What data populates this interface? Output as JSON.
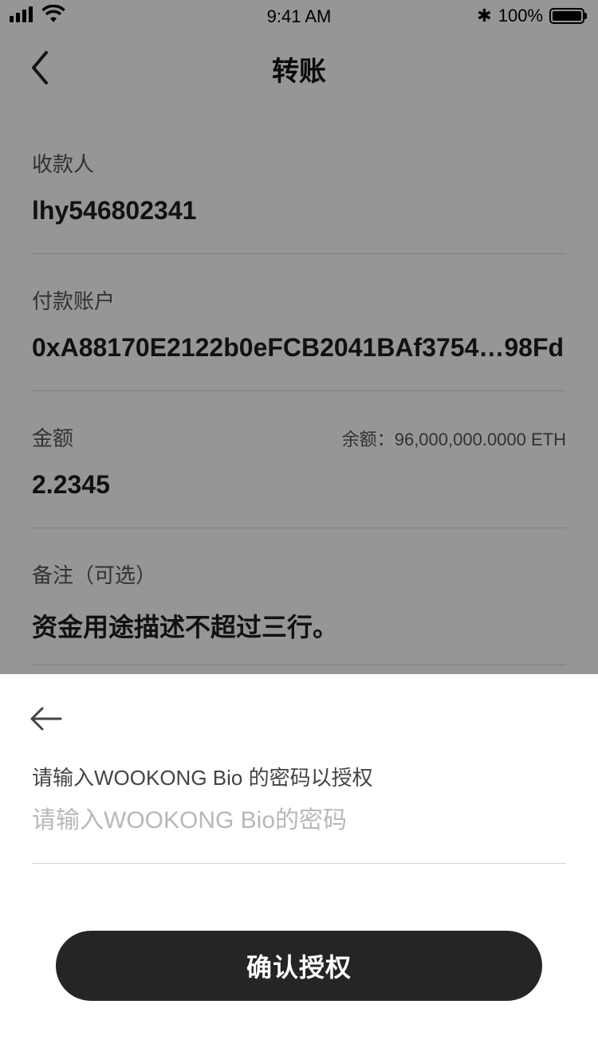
{
  "status_bar": {
    "time": "9:41 AM",
    "battery": "100%"
  },
  "nav": {
    "title": "转账"
  },
  "form": {
    "payee": {
      "label": "收款人",
      "value": "lhy546802341"
    },
    "account": {
      "label": "付款账户",
      "value": "0xA88170E2122b0eFCB2041BAf3754…98Fd"
    },
    "amount": {
      "label": "金额",
      "balance": "余额：96,000,000.0000 ETH",
      "value": "2.2345"
    },
    "note": {
      "label": "备注（可选）",
      "value": "资金用途描述不超过三行。"
    }
  },
  "auth_sheet": {
    "prompt": "请输入WOOKONG Bio 的密码以授权",
    "password_placeholder": "请输入WOOKONG Bio的密码",
    "password_value": "",
    "confirm_label": "确认授权"
  }
}
